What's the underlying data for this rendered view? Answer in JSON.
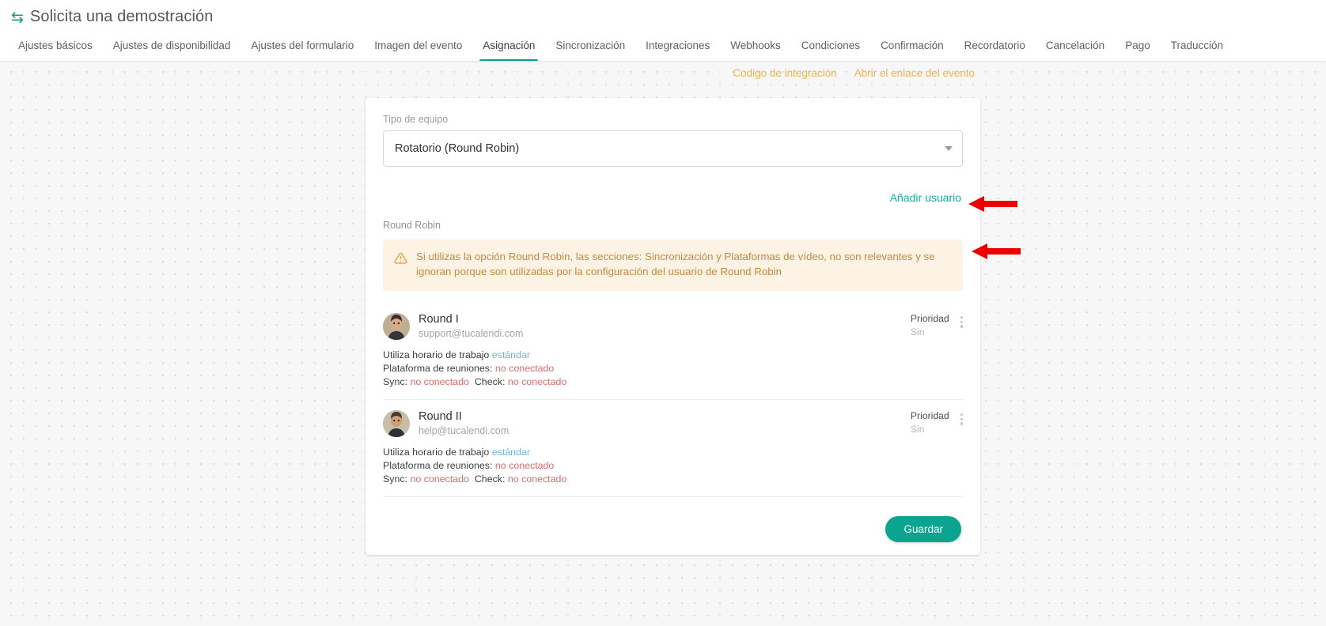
{
  "header": {
    "icon": "exchange-icon",
    "title": "Solicita una demostración",
    "tabs": [
      {
        "label": "Ajustes básicos",
        "active": false
      },
      {
        "label": "Ajustes de disponibilidad",
        "active": false
      },
      {
        "label": "Ajustes del formulario",
        "active": false
      },
      {
        "label": "Imagen del evento",
        "active": false
      },
      {
        "label": "Asignación",
        "active": true
      },
      {
        "label": "Sincronización",
        "active": false
      },
      {
        "label": "Integraciones",
        "active": false
      },
      {
        "label": "Webhooks",
        "active": false
      },
      {
        "label": "Condiciones",
        "active": false
      },
      {
        "label": "Confirmación",
        "active": false
      },
      {
        "label": "Recordatorio",
        "active": false
      },
      {
        "label": "Cancelación",
        "active": false
      },
      {
        "label": "Pago",
        "active": false
      },
      {
        "label": "Traducción",
        "active": false
      }
    ]
  },
  "top_links": {
    "integration_code": "Codigo de integración",
    "open_event_link": "Abrir el enlace del evento"
  },
  "form": {
    "team_type_label": "Tipo de equipo",
    "team_type_value": "Rotatorio (Round Robin)",
    "add_user_link": "Añadir usuario",
    "section_label": "Round Robin"
  },
  "alert": {
    "icon": "warning-triangle-icon",
    "text": "Si utilizas la opción Round Robin, las secciones: Sincronización y Plataformas de vídeo, no son relevantes y se ignoran porque son utilizadas por la configuración del usuario de Round Robin"
  },
  "users": [
    {
      "name": "Round I",
      "email": "support@tucalendi.com",
      "priority_label": "Prioridad",
      "priority_value": "Sin",
      "schedule_prefix": "Utiliza horario de trabajo",
      "schedule_value": "estándar",
      "platform_prefix": "Plataforma de reuniones:",
      "platform_value": "no conectado",
      "sync_prefix": "Sync:",
      "sync_value": "no conectado",
      "check_prefix": "Check:",
      "check_value": "no conectado"
    },
    {
      "name": "Round II",
      "email": "help@tucalendi.com",
      "priority_label": "Prioridad",
      "priority_value": "Sin",
      "schedule_prefix": "Utiliza horario de trabajo",
      "schedule_value": "estándar",
      "platform_prefix": "Plataforma de reuniones:",
      "platform_value": "no conectado",
      "sync_prefix": "Sync:",
      "sync_value": "no conectado",
      "check_prefix": "Check:",
      "check_value": "no conectado"
    }
  ],
  "actions": {
    "save_label": "Guardar"
  },
  "colors": {
    "brand_teal": "#0e9e8e",
    "link_teal": "#0fb39c",
    "link_amber": "#f0b44a",
    "alert_bg": "#fdf3e4",
    "alert_text": "#c8893b",
    "error_red": "#e26a6a",
    "info_blue": "#6cb4e4",
    "annotation_red": "#ee0000"
  }
}
